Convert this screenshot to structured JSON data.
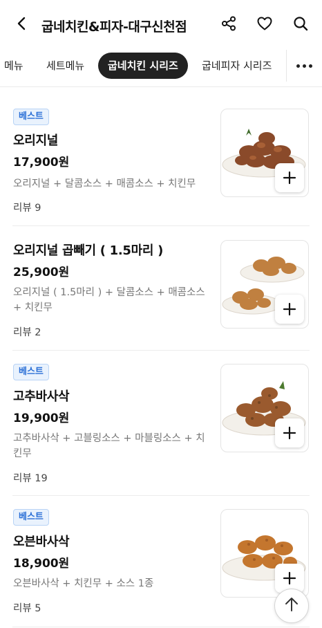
{
  "header": {
    "title": "굽네치킨&피자-대구신천점",
    "icons": {
      "back": "chevron-left-icon",
      "share": "share-icon",
      "favorite": "heart-icon",
      "search": "search-icon"
    }
  },
  "tabs": {
    "items": [
      {
        "label": "메뉴",
        "active": false
      },
      {
        "label": "세트메뉴",
        "active": false
      },
      {
        "label": "굽네치킨 시리즈",
        "active": true
      },
      {
        "label": "굽네피자 시리즈",
        "active": false
      }
    ],
    "more_icon": "more-horizontal-icon"
  },
  "menu_items": [
    {
      "badge": "베스트",
      "name": "오리지널",
      "price": "17,900원",
      "desc": "오리지널 + 달콤소스 + 매콤소스 + 치킨무",
      "review": "리뷰 9",
      "image": "roast-chicken-plate"
    },
    {
      "badge": "",
      "name": "오리지널 곱빼기 ( 1.5마리 )",
      "price": "25,900원",
      "desc": "오리지널 ( 1.5마리 ) + 달콤소스 + 매콤소스 + 치킨무",
      "review": "리뷰 2",
      "image": "roast-chicken-two-plates"
    },
    {
      "badge": "베스트",
      "name": "고추바사삭",
      "price": "19,900원",
      "desc": "고추바사삭 + 고블링소스 + 마블링소스 + 치킨무",
      "review": "리뷰 19",
      "image": "crispy-chicken-plate"
    },
    {
      "badge": "베스트",
      "name": "오븐바사삭",
      "price": "18,900원",
      "desc": "오븐바사삭 + 치킨무 + 소스 1종",
      "review": "리뷰 5",
      "image": "oven-crispy-chicken-plate"
    }
  ],
  "colors": {
    "badge_text": "#2a6fd6",
    "badge_bg": "#e9f2fd",
    "active_tab_bg": "#222222"
  }
}
